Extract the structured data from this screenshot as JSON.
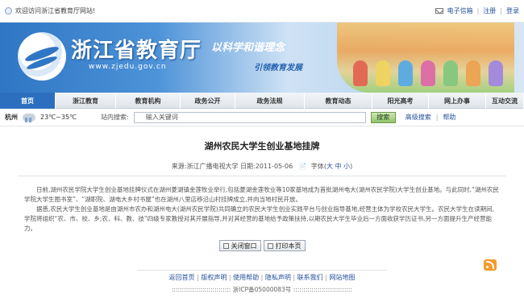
{
  "topbar": {
    "welcome": "欢迎访问浙江省教育厅网站!",
    "mail": "电子信箱",
    "register": "注册",
    "login": "登录"
  },
  "banner": {
    "title": "浙江省教育厅",
    "url": "www.zjedu.gov.cn",
    "slogan1": "以科学和谐理念",
    "slogan2": "引领教育发展"
  },
  "nav": {
    "items": [
      {
        "label": "首页",
        "active": true
      },
      {
        "label": "浙江教育"
      },
      {
        "label": "教育机构"
      },
      {
        "label": "政务公开"
      },
      {
        "label": "政务法规"
      },
      {
        "label": "教育动态"
      },
      {
        "label": "阳光高考"
      },
      {
        "label": "网上办事"
      },
      {
        "label": "互动交流"
      }
    ]
  },
  "info": {
    "city": "杭州",
    "weather_icon": "cloud-rain-icon",
    "temperature": "23℃~35℃",
    "search_label": "站内搜索:",
    "search_placeholder": "输入关键词",
    "search_button": "搜索",
    "advanced": "高级搜索",
    "help": "帮助"
  },
  "article": {
    "title": "湖州农民大学生创业基地挂牌",
    "source": "来源:浙江广播电视大学",
    "date": "日期:2011-05-06",
    "font_label": "字体(",
    "font_big": "大",
    "font_mid": "中",
    "font_small": "小",
    "font_end": ")",
    "p1": "日前,湖州农民学院大学生创业基地挂牌仪式在湖州菱湖镇金莲牧业举行,包括菱湖金莲牧业等10家基地成为首批湖州电大(湖州农民学院)大学生创业基地。与此同时,“湖州农民学院大学生图书室”、“湖职院、湖电大乡村书屋”也在湖州八里店移沿山村挂牌成立,并向当地村民开放。",
    "p2": "据悉,农民大学生创业基地是由湖州市农办和湖州电大(湖州农民学院)共同确立的农民大学生创业实践平台与创业指导基地,经营主体为学校农民大学生。农民大学生在读期间,学院将组织“农、市、校、乡;农、科、教、技”四级专家教授对其开展指导,并对其经营的基地给予政策扶持,以期农民大学生毕业后一方面收获学历证书,另一方面提升生产经营能力。",
    "close_btn": "关闭窗口",
    "print_btn": "打印本页"
  },
  "footer": {
    "links": [
      "返回首页",
      "版权声明",
      "使用帮助",
      "隐私声明",
      "联系我们",
      "网站地图"
    ],
    "icp": "::::::::::::::::::::::::::::: 浙ICP备05000083号 :::::::::::::::::::::::::::::"
  }
}
